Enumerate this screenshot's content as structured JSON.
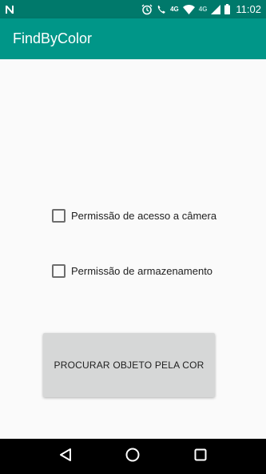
{
  "status_bar": {
    "network_4g_label": "4G",
    "mobile_4g_label": "4G",
    "time": "11:02"
  },
  "app_bar": {
    "title": "FindByColor"
  },
  "permissions": {
    "camera_label": "Permissão de acesso a câmera",
    "camera_checked": false,
    "storage_label": "Permissão de armazenamento",
    "storage_checked": false
  },
  "main_button": {
    "label": "PROCURAR OBJETO PELA COR"
  },
  "colors": {
    "status_bar": "#00796b",
    "app_bar": "#009688",
    "background": "#fafafa",
    "button": "#d6d7d7",
    "nav_bar": "#000000"
  },
  "icons": {
    "status_left": "n-notification-icon",
    "alarm": "alarm-icon",
    "wifi_call": "wifi-call-icon",
    "wifi": "wifi-icon",
    "signal": "signal-icon",
    "battery": "battery-icon",
    "nav_back": "back-icon",
    "nav_home": "home-icon",
    "nav_recents": "recents-icon"
  }
}
